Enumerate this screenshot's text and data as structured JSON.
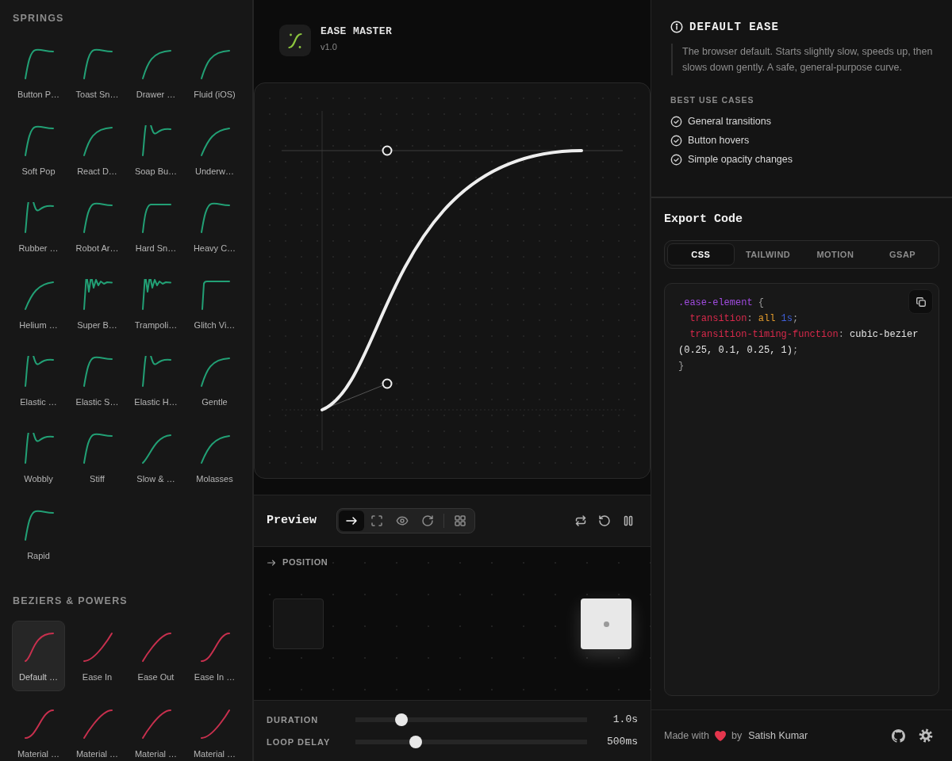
{
  "sidebar": {
    "sections": [
      {
        "title": "SPRINGS",
        "kind": "spring",
        "items": [
          {
            "label": "Button P…",
            "kind": "overshoot",
            "selected": false
          },
          {
            "label": "Toast Sn…",
            "kind": "overshoot",
            "selected": false
          },
          {
            "label": "Drawer …",
            "kind": "smooth",
            "selected": false
          },
          {
            "label": "Fluid (iOS)",
            "kind": "smooth",
            "selected": false
          },
          {
            "label": "Soft Pop",
            "kind": "overshoot",
            "selected": false
          },
          {
            "label": "React D…",
            "kind": "smooth",
            "selected": false
          },
          {
            "label": "Soap Bu…",
            "kind": "wobble",
            "selected": false
          },
          {
            "label": "Underw…",
            "kind": "slow",
            "selected": false
          },
          {
            "label": "Rubber …",
            "kind": "wobble",
            "selected": false
          },
          {
            "label": "Robot Ar…",
            "kind": "overshoot",
            "selected": false
          },
          {
            "label": "Hard Sn…",
            "kind": "snap",
            "selected": false
          },
          {
            "label": "Heavy C…",
            "kind": "overshoot",
            "selected": false
          },
          {
            "label": "Helium …",
            "kind": "slow",
            "selected": false
          },
          {
            "label": "Super B…",
            "kind": "jitter",
            "selected": false
          },
          {
            "label": "Trampoli…",
            "kind": "jitter",
            "selected": false
          },
          {
            "label": "Glitch Vi…",
            "kind": "step",
            "selected": false
          },
          {
            "label": "Elastic …",
            "kind": "wobble",
            "selected": false
          },
          {
            "label": "Elastic S…",
            "kind": "overshoot",
            "selected": false
          },
          {
            "label": "Elastic H…",
            "kind": "wobble",
            "selected": false
          },
          {
            "label": "Gentle",
            "kind": "smooth",
            "selected": false
          },
          {
            "label": "Wobbly",
            "kind": "wobble",
            "selected": false
          },
          {
            "label": "Stiff",
            "kind": "overshoot",
            "selected": false
          },
          {
            "label": "Slow & …",
            "kind": "gradual",
            "selected": false
          },
          {
            "label": "Molasses",
            "kind": "slow",
            "selected": false
          },
          {
            "label": "Rapid",
            "kind": "overshoot",
            "selected": false
          }
        ]
      },
      {
        "title": "BEZIERS & POWERS",
        "kind": "bezier",
        "items": [
          {
            "label": "Default …",
            "kind": "ease",
            "selected": true
          },
          {
            "label": "Ease In",
            "kind": "ease-in",
            "selected": false
          },
          {
            "label": "Ease Out",
            "kind": "ease-out",
            "selected": false
          },
          {
            "label": "Ease In …",
            "kind": "ease-in-out",
            "selected": false
          },
          {
            "label": "Material …",
            "kind": "ease-in-out",
            "selected": false
          },
          {
            "label": "Material …",
            "kind": "ease-out",
            "selected": false
          },
          {
            "label": "Material …",
            "kind": "ease-out",
            "selected": false
          },
          {
            "label": "Material …",
            "kind": "ease-in",
            "selected": false
          }
        ]
      }
    ]
  },
  "app": {
    "title": "EASE MASTER",
    "version": "v1.0"
  },
  "preview": {
    "title": "Preview",
    "modes": [
      {
        "kind": "position",
        "selected": true
      },
      {
        "kind": "scale",
        "selected": false
      },
      {
        "kind": "opacity",
        "selected": false
      },
      {
        "kind": "rotate",
        "selected": false
      },
      {
        "kind": "grid",
        "selected": false
      }
    ],
    "stage_label": "POSITION",
    "controls": [
      {
        "label": "DURATION",
        "level": 0.2,
        "reading": "1.0s"
      },
      {
        "label": "LOOP DELAY",
        "level": 0.26,
        "reading": "500ms"
      }
    ]
  },
  "details": {
    "title": "DEFAULT EASE",
    "description": "The browser default. Starts slightly slow, speeds up, then slows down gently. A safe, general-purpose curve.",
    "use_cases_title": "BEST USE CASES",
    "use_cases": [
      "General transitions",
      "Button hovers",
      "Simple opacity changes"
    ]
  },
  "export": {
    "title": "Export Code",
    "tabs": [
      {
        "label": "CSS",
        "selected": true
      },
      {
        "label": "TAILWIND",
        "selected": false
      },
      {
        "label": "MOTION",
        "selected": false
      },
      {
        "label": "GSAP",
        "selected": false
      }
    ],
    "code": [
      {
        "indented": false,
        "tokens": [
          {
            "kind": "selector",
            "text": ".ease-element"
          },
          {
            "kind": "punct",
            "text": " {"
          }
        ]
      },
      {
        "indented": true,
        "tokens": [
          {
            "kind": "property",
            "text": "transition"
          },
          {
            "kind": "punct",
            "text": ":"
          },
          {
            "kind": "keyword",
            "text": " all"
          },
          {
            "kind": "number",
            "text": " 1s"
          },
          {
            "kind": "punct",
            "text": ";"
          }
        ]
      },
      {
        "indented": true,
        "tokens": [
          {
            "kind": "property",
            "text": "transition-timing-function"
          },
          {
            "kind": "punct",
            "text": ":"
          },
          {
            "kind": "value",
            "text": " cubic-bezier"
          },
          {
            "kind": "value",
            "text": "(0.25, 0.1, 0.25, 1)"
          },
          {
            "kind": "punct",
            "text": ";"
          }
        ]
      },
      {
        "indented": false,
        "tokens": [
          {
            "kind": "punct",
            "text": "}"
          }
        ]
      }
    ]
  },
  "footer": {
    "prefix": "Made with",
    "by": "by",
    "author": "Satish Kumar"
  }
}
